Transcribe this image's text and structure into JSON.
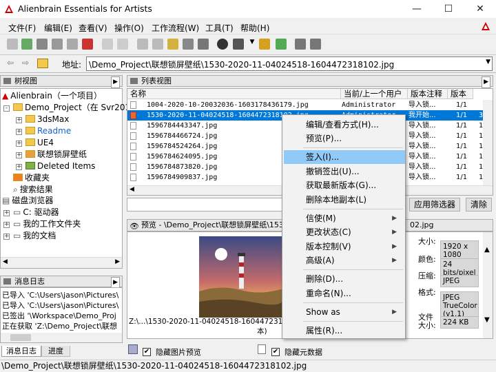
{
  "window": {
    "title": "Alienbrain Essentials for Artists"
  },
  "menu": [
    "文件(F)",
    "编辑(E)",
    "查看(V)",
    "操作(O)",
    "工作流程(W)",
    "工具(T)",
    "帮助(H)"
  ],
  "address": {
    "label": "地址:",
    "value": "\\Demo_Project\\联想锁屏壁纸\\1530-2020-11-04024518-1604472318102.jpg"
  },
  "tree": {
    "title": "树视图",
    "items": [
      "Alienbrain（一个项目）",
      "Demo_Project（在 Svr2012",
      "3dsMax",
      "Readme",
      "UE4",
      "联想锁屏壁纸",
      "Deleted Items",
      "收藏夹",
      "搜索结果",
      "磁盘浏览器",
      "C:  驱动器",
      "我的工作文件夹",
      "我的文档"
    ]
  },
  "list": {
    "title": "列表视图",
    "columns": [
      "名称",
      "当前/上一个用户",
      "版本注释",
      "版本"
    ],
    "rows": [
      {
        "name": "1004-2020-10-20032036-1603178436179.jpg",
        "user": "Administrator",
        "comment": "导入锁...",
        "version": "1/1",
        "extra": ""
      },
      {
        "name": "1530-2020-11-04024518-1604472318102.jpg",
        "user": "Administrator",
        "comment": "我开始...",
        "version": "1/1",
        "extra": "3."
      },
      {
        "name": "1596784443347.jpg",
        "user": "",
        "comment": "导入锁...",
        "version": "1/1",
        "extra": "1."
      },
      {
        "name": "1596784466724.jpg",
        "user": "",
        "comment": "导入锁...",
        "version": "1/1",
        "extra": "1."
      },
      {
        "name": "1596784524264.jpg",
        "user": "",
        "comment": "导入锁...",
        "version": "1/1",
        "extra": "1."
      },
      {
        "name": "1596784624095.jpg",
        "user": "",
        "comment": "导入锁...",
        "version": "1/1",
        "extra": "1."
      },
      {
        "name": "1596784873820.jpg",
        "user": "",
        "comment": "导入锁...",
        "version": "1/1",
        "extra": "1."
      },
      {
        "name": "1596784909837.jpg",
        "user": "",
        "comment": "导入锁...",
        "version": "1/1",
        "extra": "1."
      }
    ],
    "apply_filter": "应用筛选器",
    "clear": "清除"
  },
  "context_menu": {
    "items": [
      "编辑/查看方式(H)...",
      "预览(P)...",
      "签入(I)...",
      "撤销签出(U)...",
      "获取最新版本(G)...",
      "删除本地副本(L)",
      "信使(M)",
      "更改状态(C)",
      "版本控制(V)",
      "高级(A)",
      "删除(D)...",
      "重命名(N)...",
      "Show as",
      "属性(R)..."
    ],
    "highlighted": "签入(I)..."
  },
  "preview": {
    "title_prefix": "预览 - \\Demo_Project\\联想锁屏壁纸\\1530-",
    "title_suffix": "02.jpg",
    "caption": "Z:\\...\\1530-2020-11-04024518-1604472318102.jpg",
    "caption2": "本)",
    "props": [
      {
        "k": "大小:",
        "v": "1920 x 1080"
      },
      {
        "k": "颜色:",
        "v": "24 bits/pixel"
      },
      {
        "k": "压缩:",
        "v": "JPEG"
      },
      {
        "k": "格式:",
        "v": "JPEG TrueColor (v1.1)"
      },
      {
        "k": "文件大小:",
        "v": "224 KB"
      }
    ],
    "hide_preview": "隐藏图片预览",
    "hide_meta": "隐藏元数据"
  },
  "log": {
    "title": "消息日志",
    "lines": [
      "已导入 'C:\\Users\\jason\\Pictures\\",
      "已导入 'C:\\Users\\jason\\Pictures\\",
      "已签出 '\\Workspace\\Demo_Proj",
      "正在获取 'Z:\\Demo_Project\\联想"
    ],
    "tabs": [
      "消息日志",
      "进度"
    ]
  },
  "status": "\\Demo_Project\\联想锁屏壁纸\\1530-2020-11-04024518-1604472318102.jpg",
  "colors": {
    "accent": "#0078d7",
    "highlight": "#91c9f7"
  }
}
